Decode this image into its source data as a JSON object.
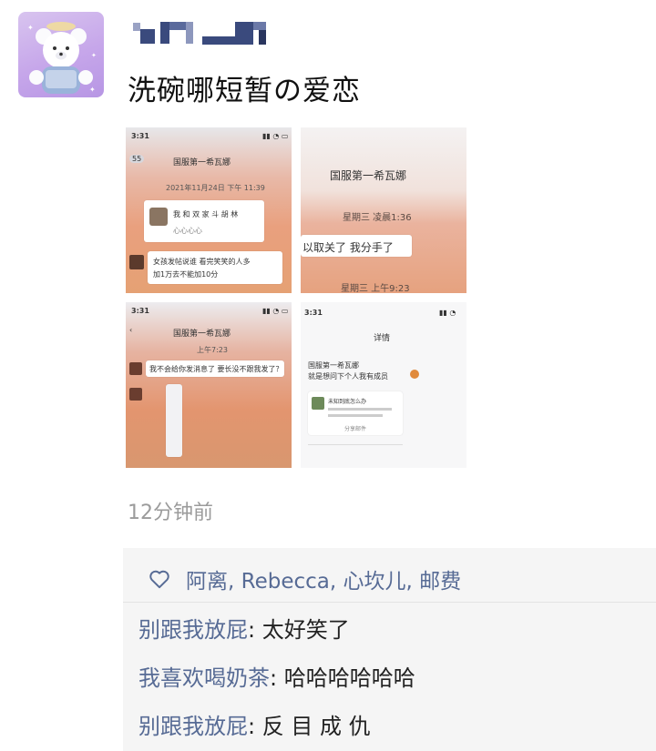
{
  "post": {
    "text": "洗碗哪短暂の爱恋",
    "time": "12分钟前"
  },
  "screenshots": {
    "s1": {
      "status_time": "3:31",
      "back_count": "55",
      "chat_title": "国服第一希瓦娜",
      "date_stamp": "2021年11月24日 下午 11:39",
      "card_text": "我 和 双 家 斗 胡 林",
      "card_sub": "心心心心",
      "msg": "女孩发帖说谁 看完笑笑的人多",
      "msg2": "加1万去不能加10分"
    },
    "s2": {
      "chat_title": "国服第一希瓦娜",
      "time1": "星期三 凌晨1:36",
      "msg": "以取关了 我分手了",
      "time2": "星期三 上午9:23"
    },
    "s3": {
      "status_time": "3:31",
      "chat_title": "国服第一希瓦娜",
      "stamp": "上午7:23",
      "msg": "我不会给你发消息了 要长没不跟我发了？"
    },
    "s4": {
      "status_time": "3:31",
      "title": "详情",
      "line1": "国服第一希瓦娜",
      "line2": "就是想问下个人我有成员",
      "card_title": "未知到底怎么办",
      "card_foot": "分享邮件"
    }
  },
  "likes": {
    "icon": "heart-outline-icon",
    "names": "阿离, Rebecca, 心坎儿, 邮费"
  },
  "comments": [
    {
      "name": "别跟我放屁",
      "text": "太好笑了"
    },
    {
      "name": "我喜欢喝奶茶",
      "text": "哈哈哈哈哈哈"
    },
    {
      "name": "别跟我放屁",
      "text": "反 目 成 仇"
    }
  ],
  "colors": {
    "link": "#576b95",
    "panel_bg": "#f5f5f5",
    "avatar_bg": "#c6a6ea"
  }
}
